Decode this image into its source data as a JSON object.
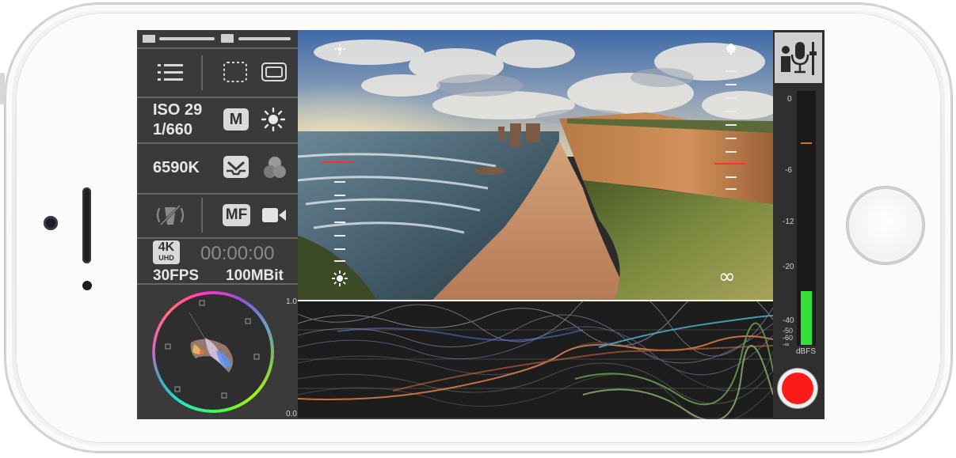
{
  "exposure": {
    "iso": "ISO 29",
    "shutter": "1/660",
    "mode_label": "M"
  },
  "white_balance": {
    "kelvin": "6590K"
  },
  "focus": {
    "mode_label": "MF"
  },
  "recording": {
    "resolution_badge": "4K",
    "resolution_sub": "UHD",
    "timecode": "00:00:00",
    "fps": "30FPS",
    "bitrate": "100MBit"
  },
  "waveform": {
    "top_label": "1.0",
    "bottom_label": "0.0"
  },
  "audio_meter": {
    "scale": [
      "0",
      "-6",
      "-12",
      "-20",
      "-40",
      "-50",
      "-60",
      "-∞"
    ],
    "unit": "dBFS",
    "level_db": -40,
    "peak_marker_db": -3
  },
  "focus_slider": {
    "infinity_symbol": "∞"
  },
  "colors": {
    "record": "#ff1a1a",
    "meter_green": "#35e03a",
    "meter_peak": "#e07020",
    "slider_red": "#ff3030"
  }
}
